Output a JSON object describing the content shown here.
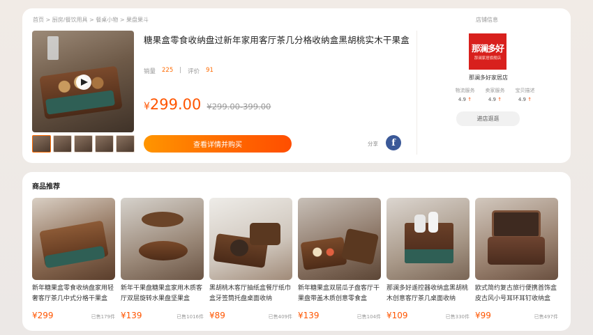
{
  "breadcrumb": "首页 > 厨房/餐饮用具 > 餐桌小物 > 果盘果斗",
  "product": {
    "title": "糖果盒零食收纳盘过新年家用客厅茶几分格收纳盒黑胡桃实木干果盒",
    "sales_label": "销量",
    "sales_value": "225",
    "separator": "|",
    "reviews_label": "评价",
    "reviews_value": "91",
    "price_currency": "¥",
    "price_value": "299.00",
    "original_price": "¥299.00-399.00",
    "buy_button": "查看详情并购买",
    "share_label": "分享",
    "facebook_glyph": "f"
  },
  "store": {
    "header": "店铺信息",
    "logo_text": "那澜多好",
    "logo_subtext": "那澜家居旗舰店",
    "name": "那澜多好家居店",
    "ratings": [
      {
        "label": "物流服务",
        "value": "4.9",
        "arrow": "↑"
      },
      {
        "label": "卖家服务",
        "value": "4.9",
        "arrow": "↑"
      },
      {
        "label": "宝贝描述",
        "value": "4.9",
        "arrow": "↑"
      }
    ],
    "enter_button": "进店逛逛"
  },
  "recommend": {
    "title": "商品推荐",
    "items": [
      {
        "name": "新年糖果盒零食收纳盘家用轻奢客厅茶几中式分格干果盒",
        "price": "¥299",
        "sold": "已售179件"
      },
      {
        "name": "新年干果盘糖果盒家用木质客厅双层旋转水果盘坚果盒",
        "price": "¥139",
        "sold": "已售1016件"
      },
      {
        "name": "黑胡桃木客厅抽纸盒餐厅纸巾盒牙签筒托盘桌面收纳",
        "price": "¥89",
        "sold": "已售409件"
      },
      {
        "name": "新年糖果盒双层瓜子盘客厅干果盘带盖木质创意零食盒",
        "price": "¥139",
        "sold": "已售104件"
      },
      {
        "name": "那澜多好遥控器收纳盒黑胡桃木创意客厅茶几桌面收纳",
        "price": "¥109",
        "sold": "已售330件"
      },
      {
        "name": "欧式简约复古旅行便携首饰盒皮古风小号耳环耳钉收纳盒",
        "price": "¥99",
        "sold": "已售497件"
      }
    ]
  },
  "colors": {
    "accent": "#ff6a00",
    "price": "#ff5500",
    "store_logo_bg": "#d8201d",
    "facebook": "#3b5998"
  },
  "icons": {
    "play": "play-icon",
    "facebook": "facebook-icon",
    "rating_up": "arrow-up-icon"
  }
}
